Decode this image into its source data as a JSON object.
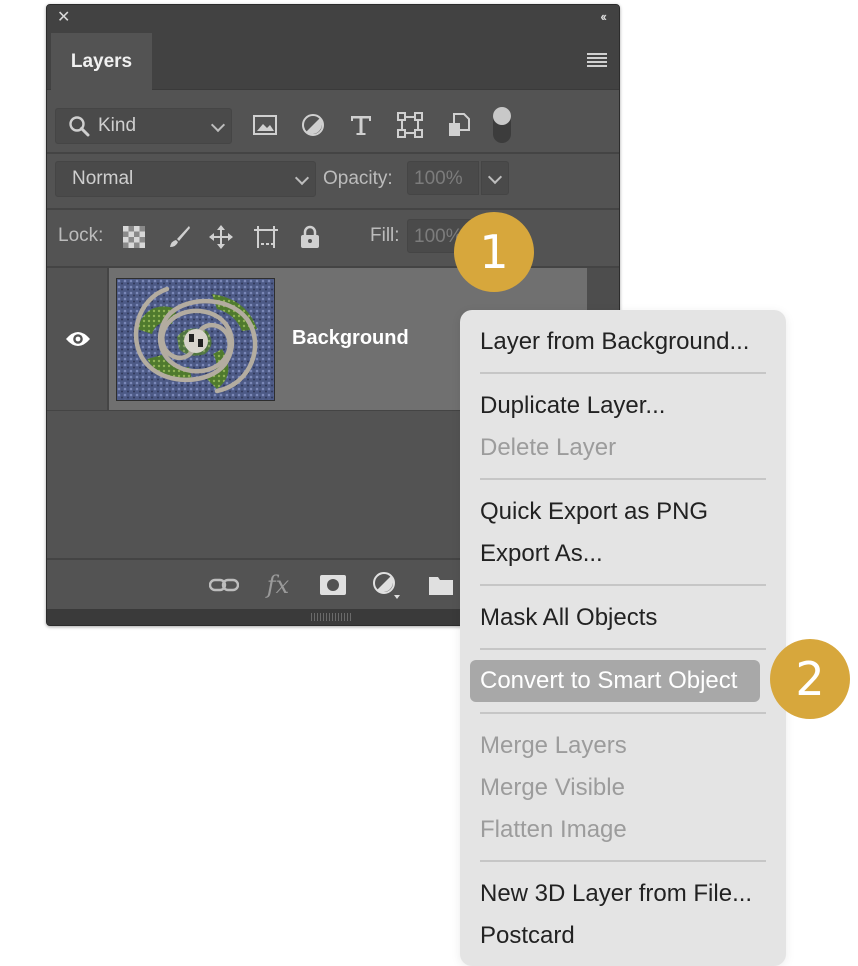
{
  "panel": {
    "tab_label": "Layers",
    "close_glyph": "✕",
    "collapse_glyph": "‹‹",
    "filter": {
      "kind_label": "Kind",
      "icons": [
        "image-filter-icon",
        "adjustment-filter-icon",
        "type-filter-icon",
        "shape-filter-icon",
        "smart-object-filter-icon"
      ]
    },
    "blend_mode": "Normal",
    "opacity_label": "Opacity:",
    "opacity_value": "100%",
    "lock_label": "Lock:",
    "fill_label": "Fill:",
    "fill_value": "100%",
    "layers": [
      {
        "name": "Background",
        "visible": true,
        "selected": true
      }
    ],
    "bottom_icons": [
      "link-icon",
      "fx-icon",
      "mask-icon",
      "adjustment-icon",
      "folder-icon"
    ],
    "fx_text": "fx"
  },
  "context_menu": {
    "items": [
      {
        "label": "Layer from Background...",
        "enabled": true
      },
      {
        "label": "Duplicate Layer...",
        "enabled": true
      },
      {
        "label": "Delete Layer",
        "enabled": false
      },
      {
        "label": "Quick Export as PNG",
        "enabled": true
      },
      {
        "label": "Export As...",
        "enabled": true
      },
      {
        "label": "Mask All Objects",
        "enabled": true
      },
      {
        "label": "Convert to Smart Object",
        "enabled": true,
        "highlighted": true
      },
      {
        "label": "Merge Layers",
        "enabled": false
      },
      {
        "label": "Merge Visible",
        "enabled": false
      },
      {
        "label": "Flatten Image",
        "enabled": false
      },
      {
        "label": "New 3D Layer from File...",
        "enabled": true
      },
      {
        "label": "Postcard",
        "enabled": true
      }
    ]
  },
  "callouts": {
    "first": "1",
    "second": "2",
    "color": "#d7a73c"
  },
  "colors": {
    "panel_bg": "#535353",
    "selected_row": "#707070",
    "menu_bg": "#e4e4e4",
    "menu_highlight": "#a8a8a8"
  }
}
